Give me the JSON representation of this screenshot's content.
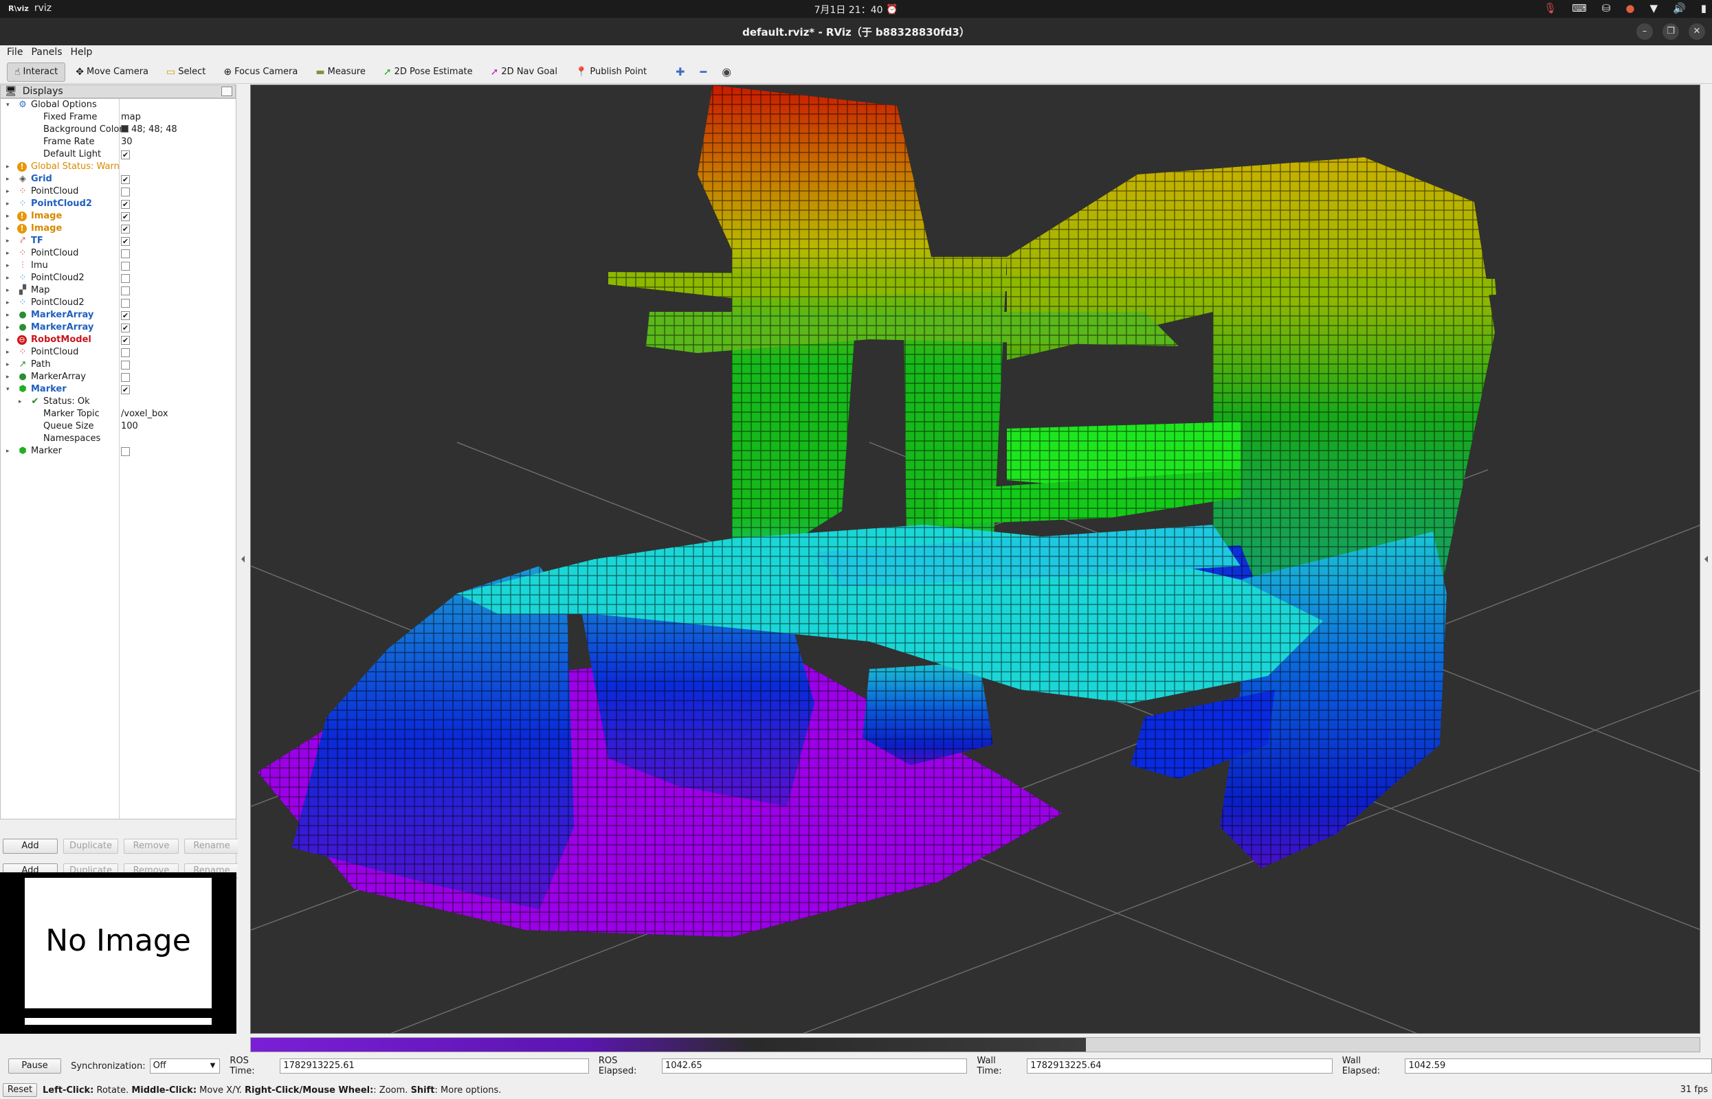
{
  "topbar": {
    "app_logo": "R\\viz",
    "app_name": "rviz",
    "date": "7月1日",
    "time": "21：40",
    "tray_icons": [
      "mic-icon",
      "keyboard-icon",
      "network-icon",
      "app-icon",
      "wifi-icon",
      "volume-icon",
      "battery-icon"
    ]
  },
  "window": {
    "title": "default.rviz* - RViz（于 b88328830fd3）"
  },
  "menu": [
    "File",
    "Panels",
    "Help"
  ],
  "toolbar": {
    "tools": [
      {
        "label": "Interact",
        "icon": "hand-icon",
        "active": true
      },
      {
        "label": "Move Camera",
        "icon": "move-camera-icon",
        "active": false
      },
      {
        "label": "Select",
        "icon": "select-icon",
        "active": false
      },
      {
        "label": "Focus Camera",
        "icon": "focus-icon",
        "active": false
      },
      {
        "label": "Measure",
        "icon": "ruler-icon",
        "active": false
      },
      {
        "label": "2D Pose Estimate",
        "icon": "pose-arrow-icon",
        "active": false
      },
      {
        "label": "2D Nav Goal",
        "icon": "nav-arrow-icon",
        "active": false
      },
      {
        "label": "Publish Point",
        "icon": "pin-icon",
        "active": false
      }
    ]
  },
  "displays": {
    "title": "Displays",
    "rows": [
      {
        "level": 0,
        "expanded": true,
        "icon": "gear-icon",
        "label": "Global Options",
        "style": "normal"
      },
      {
        "level": 1,
        "label": "Fixed Frame",
        "value": "map"
      },
      {
        "level": 1,
        "label": "Background Color",
        "value": "48; 48; 48",
        "swatch": "#303030"
      },
      {
        "level": 1,
        "label": "Frame Rate",
        "value": "30"
      },
      {
        "level": 1,
        "label": "Default Light",
        "check": true
      },
      {
        "level": 0,
        "expanded": false,
        "icon": "warn-icon",
        "label": "Global Status: Warn",
        "style": "orange"
      },
      {
        "level": 0,
        "expanded": false,
        "icon": "grid-icon",
        "label": "Grid",
        "style": "blue",
        "check": true
      },
      {
        "level": 0,
        "expanded": false,
        "icon": "pointcloud-icon",
        "label": "PointCloud",
        "style": "normal",
        "check": false
      },
      {
        "level": 0,
        "expanded": false,
        "icon": "pointcloud2-icon",
        "label": "PointCloud2",
        "style": "blue",
        "check": true
      },
      {
        "level": 0,
        "expanded": false,
        "icon": "warn-icon",
        "label": "Image",
        "style": "orange",
        "check": true
      },
      {
        "level": 0,
        "expanded": false,
        "icon": "warn-icon",
        "label": "Image",
        "style": "orange",
        "check": true
      },
      {
        "level": 0,
        "expanded": false,
        "icon": "tf-icon",
        "label": "TF",
        "style": "blue",
        "check": true
      },
      {
        "level": 0,
        "expanded": false,
        "icon": "pointcloud-icon",
        "label": "PointCloud",
        "style": "normal",
        "check": false
      },
      {
        "level": 0,
        "expanded": false,
        "icon": "imu-icon",
        "label": "Imu",
        "style": "normal",
        "check": false
      },
      {
        "level": 0,
        "expanded": false,
        "icon": "pointcloud2-icon",
        "label": "PointCloud2",
        "style": "normal",
        "check": false
      },
      {
        "level": 0,
        "expanded": false,
        "icon": "map-icon",
        "label": "Map",
        "style": "normal",
        "check": false
      },
      {
        "level": 0,
        "expanded": false,
        "icon": "pointcloud2-icon",
        "label": "PointCloud2",
        "style": "normal",
        "check": false
      },
      {
        "level": 0,
        "expanded": false,
        "icon": "markerarray-icon",
        "label": "MarkerArray",
        "style": "blue",
        "check": true
      },
      {
        "level": 0,
        "expanded": false,
        "icon": "markerarray-icon",
        "label": "MarkerArray",
        "style": "blue",
        "check": true
      },
      {
        "level": 0,
        "expanded": false,
        "icon": "error-icon",
        "label": "RobotModel",
        "style": "red",
        "check": true
      },
      {
        "level": 0,
        "expanded": false,
        "icon": "pointcloud-icon",
        "label": "PointCloud",
        "style": "normal",
        "check": false
      },
      {
        "level": 0,
        "expanded": false,
        "icon": "path-icon",
        "label": "Path",
        "style": "normal",
        "check": false
      },
      {
        "level": 0,
        "expanded": false,
        "icon": "markerarray-icon",
        "label": "MarkerArray",
        "style": "normal",
        "check": false
      },
      {
        "level": 0,
        "expanded": true,
        "icon": "marker-icon",
        "label": "Marker",
        "style": "blue",
        "check": true
      },
      {
        "level": 1,
        "expanded": false,
        "icon": "check-icon",
        "label": "Status: Ok",
        "style": "normal"
      },
      {
        "level": 1,
        "label": "Marker Topic",
        "value": "/voxel_box"
      },
      {
        "level": 1,
        "label": "Queue Size",
        "value": "100"
      },
      {
        "level": 1,
        "label": "Namespaces",
        "value": ""
      },
      {
        "level": 0,
        "expanded": false,
        "icon": "marker-icon",
        "label": "Marker",
        "style": "normal",
        "check": false
      }
    ],
    "buttons": [
      "Add",
      "Duplicate",
      "Remove",
      "Rename"
    ]
  },
  "image_panel": {
    "text": "No Image"
  },
  "time": {
    "pause_label": "Pause",
    "sync_label": "Synchronization:",
    "sync_value": "Off",
    "ros_time_label": "ROS Time:",
    "ros_time": "1782913225.61",
    "ros_elapsed_label": "ROS Elapsed:",
    "ros_elapsed": "1042.65",
    "wall_time_label": "Wall Time:",
    "wall_time": "1782913225.64",
    "wall_elapsed_label": "Wall Elapsed:",
    "wall_elapsed": "1042.59"
  },
  "status": {
    "reset_label": "Reset",
    "hint_left_key": "Left-Click:",
    "hint_left": " Rotate. ",
    "hint_middle_key": "Middle-Click:",
    "hint_middle": " Move X/Y. ",
    "hint_right_key": "Right-Click/Mouse Wheel:",
    "hint_right": ": Zoom. ",
    "hint_shift_key": "Shift",
    "hint_shift": ": More options.",
    "fps": "31 fps"
  },
  "colors": {
    "background": "#303030",
    "voxel_magenta": "#9b00e6",
    "voxel_blue": "#0a1fd8",
    "voxel_cyan": "#1bd6d6",
    "voxel_green": "#17b81a",
    "voxel_yellow": "#c8c800",
    "voxel_red": "#c81a00"
  }
}
